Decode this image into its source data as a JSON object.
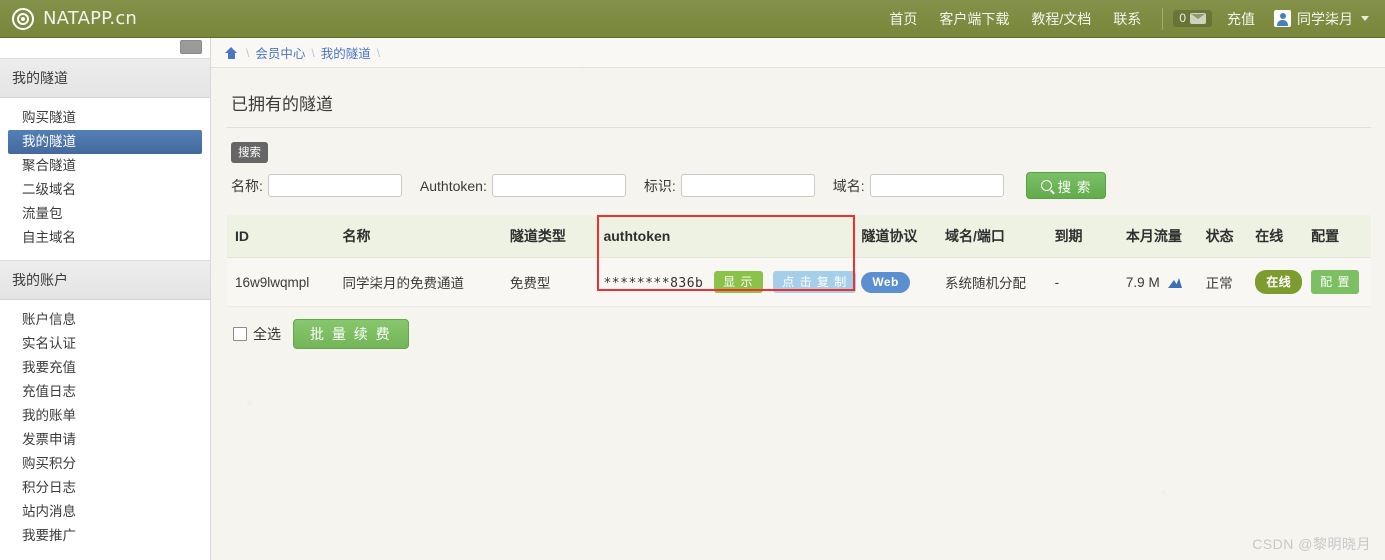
{
  "topbar": {
    "brand": "NATAPP.cn",
    "logo_icon": "spiral-target-icon",
    "nav": [
      {
        "label": "首页"
      },
      {
        "label": "客户端下载"
      },
      {
        "label": "教程/文档"
      },
      {
        "label": "联系"
      }
    ],
    "message_count": "0",
    "message_icon": "envelope-icon",
    "recharge_label": "充值",
    "user_name": "同学柒月",
    "avatar_icon": "user-avatar-icon",
    "caret_icon": "chevron-down-icon"
  },
  "sidebar": {
    "toggle_icon": "collapse-icon",
    "sections": [
      {
        "title": "我的隧道",
        "items": [
          {
            "label": "购买隧道",
            "active": false
          },
          {
            "label": "我的隧道",
            "active": true
          },
          {
            "label": "聚合隧道",
            "active": false
          },
          {
            "label": "二级域名",
            "active": false
          },
          {
            "label": "流量包",
            "active": false
          },
          {
            "label": "自主域名",
            "active": false
          }
        ]
      },
      {
        "title": "我的账户",
        "items": [
          {
            "label": "账户信息",
            "active": false
          },
          {
            "label": "实名认证",
            "active": false
          },
          {
            "label": "我要充值",
            "active": false
          },
          {
            "label": "充值日志",
            "active": false
          },
          {
            "label": "我的账单",
            "active": false
          },
          {
            "label": "发票申请",
            "active": false
          },
          {
            "label": "购买积分",
            "active": false
          },
          {
            "label": "积分日志",
            "active": false
          },
          {
            "label": "站内消息",
            "active": false
          },
          {
            "label": "我要推广",
            "active": false
          }
        ]
      }
    ]
  },
  "breadcrumb": {
    "home_icon": "home-icon",
    "separator": "\\",
    "items": [
      {
        "label": "会员中心"
      },
      {
        "label": "我的隧道"
      }
    ]
  },
  "main": {
    "page_title": "已拥有的隧道",
    "search_tag": "搜索",
    "filters": [
      {
        "label": "名称:",
        "value": "",
        "placeholder": ""
      },
      {
        "label": "Authtoken:",
        "value": "",
        "placeholder": ""
      },
      {
        "label": "标识:",
        "value": "",
        "placeholder": ""
      },
      {
        "label": "域名:",
        "value": "",
        "placeholder": ""
      }
    ],
    "search_button": "搜 索",
    "search_icon": "search-icon",
    "table": {
      "columns": [
        "ID",
        "名称",
        "隧道类型",
        "authtoken",
        "隧道协议",
        "域名/端口",
        "到期",
        "本月流量",
        "状态",
        "在线",
        "配置"
      ],
      "rows": [
        {
          "id": "16w9lwqmpl",
          "name": "同学柒月的免费通道",
          "type": "免费型",
          "authtoken_masked": "********836b",
          "show_button": "显 示",
          "copy_button": "点 击 复 制",
          "protocol": "Web",
          "domain": "系统随机分配",
          "expire": "-",
          "flow": "7.9 M",
          "flow_icon": "chart-icon",
          "status": "正常",
          "online": "在线",
          "config": "配 置"
        }
      ],
      "highlighted_column": "authtoken"
    },
    "select_all_label": "全选",
    "bulk_renew_button": "批 量 续 费"
  },
  "watermark": "CSDN @黎明晓月",
  "colors": {
    "topbar": "#7b8b3f",
    "active_item": "#4a76ab",
    "primary_green": "#70b85a",
    "highlight_red": "#f03030",
    "link_blue": "#4a76c4",
    "web_badge": "#5b8fd0",
    "online_badge": "#7d9c2f"
  }
}
